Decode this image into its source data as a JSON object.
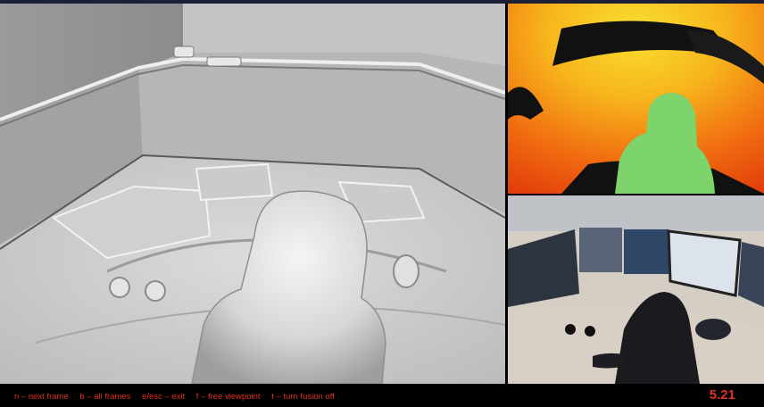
{
  "footer": {
    "hints": [
      "n – next frame",
      "b – all frames",
      "e/esc – exit",
      "f – free viewpoint",
      "t – turn fusion off"
    ],
    "fps": "5.21"
  },
  "colors": {
    "hint_text": "#e0301e",
    "background": "#000000",
    "mesh_gray": "#c8c8c8",
    "depth_near": "#7cd46a",
    "depth_far": "#f06010"
  }
}
